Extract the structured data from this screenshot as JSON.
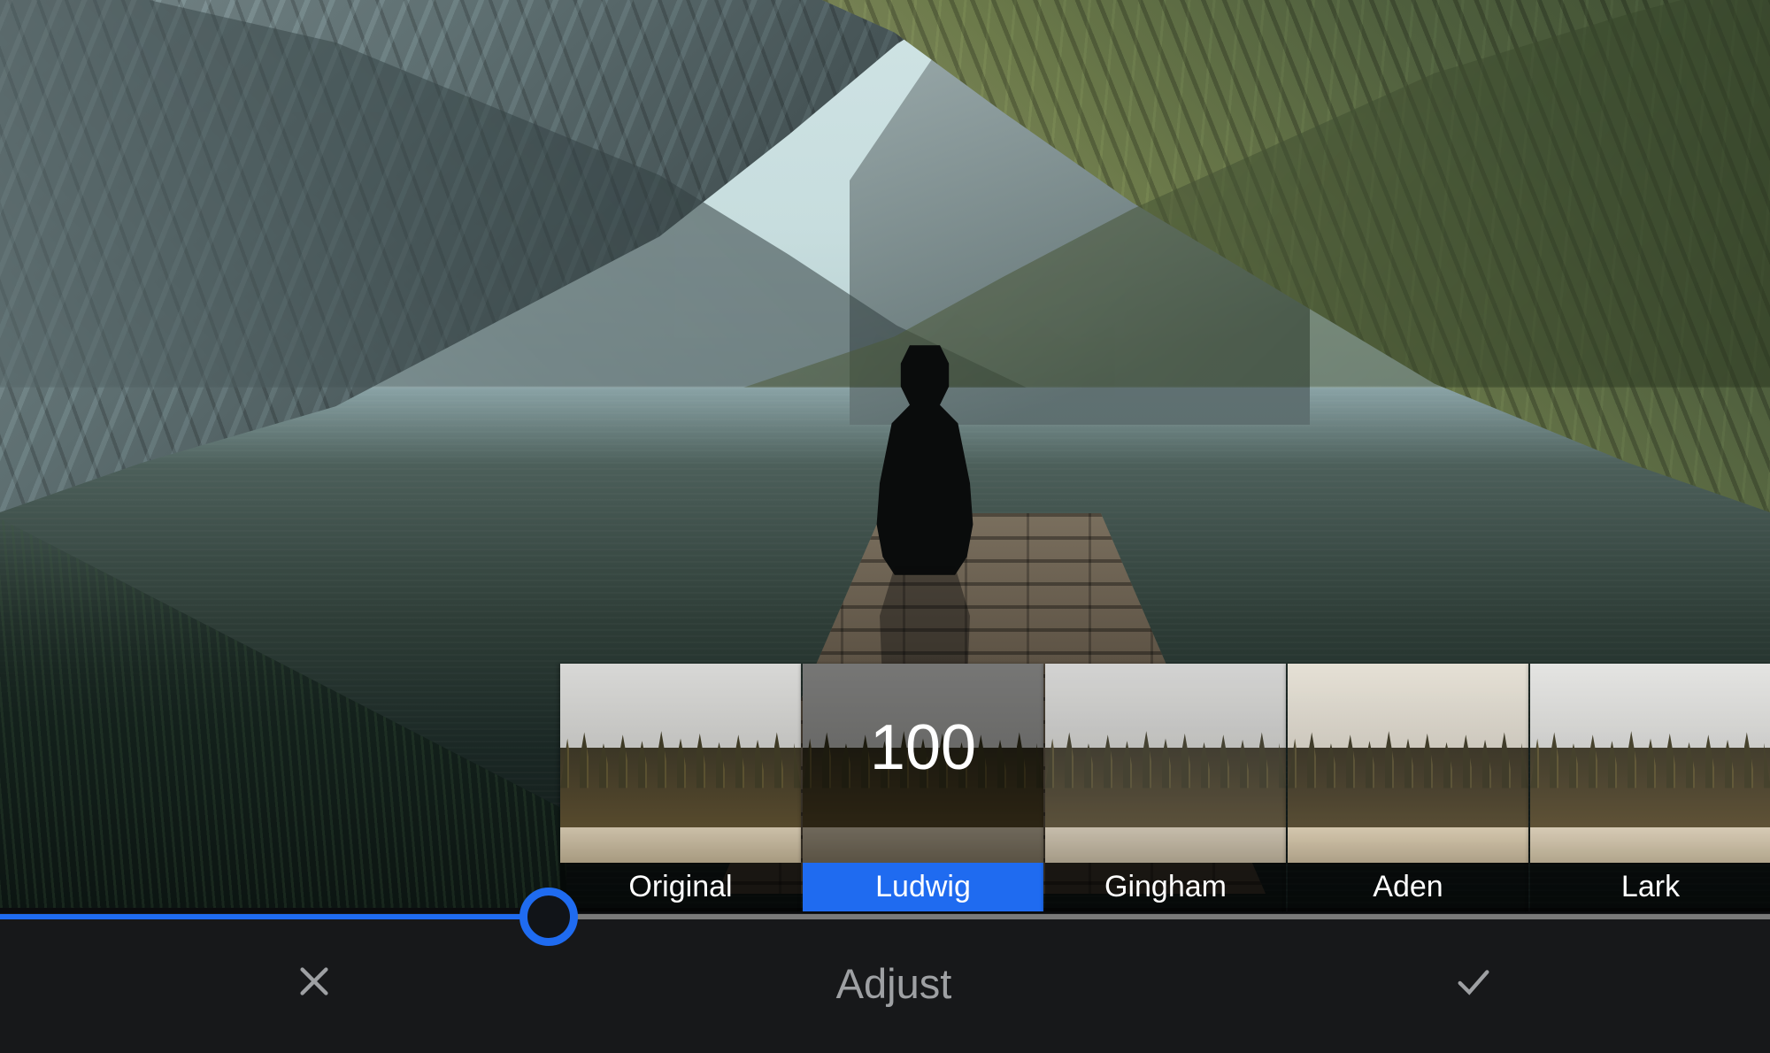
{
  "filters": {
    "items": [
      {
        "name": "Original"
      },
      {
        "name": "Ludwig"
      },
      {
        "name": "Gingham"
      },
      {
        "name": "Aden"
      },
      {
        "name": "Lark"
      }
    ],
    "selected_index": 1,
    "intensity": "100"
  },
  "slider": {
    "percent": 31
  },
  "toolbar": {
    "mode_label": "Adjust"
  },
  "colors": {
    "accent": "#1f6bf0"
  }
}
